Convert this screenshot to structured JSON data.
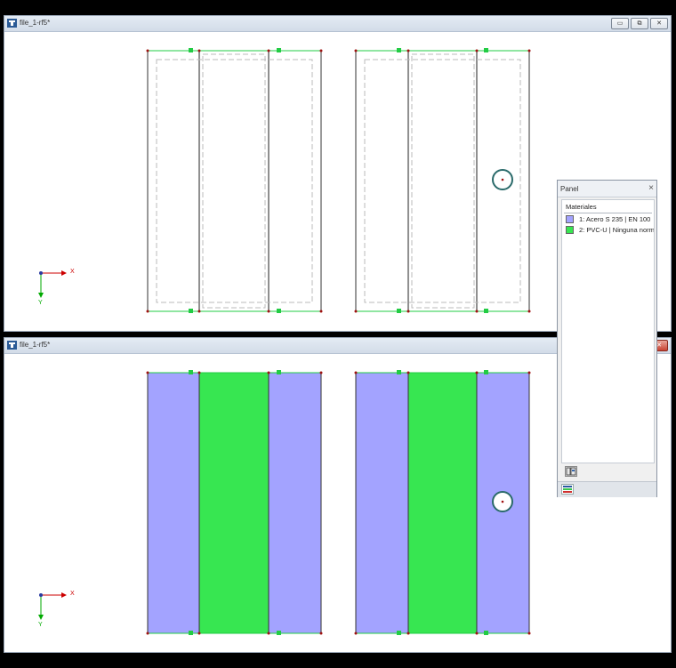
{
  "windows": [
    {
      "title": "file_1-rf5*",
      "controls": [
        "minimize",
        "maximize",
        "close"
      ]
    },
    {
      "title": "file_1-rf5*",
      "controls": [
        "close"
      ]
    }
  ],
  "axes": {
    "x_label": "X",
    "y_label": "Y"
  },
  "panel": {
    "title": "Panel",
    "section": "Materiales",
    "materials": [
      {
        "label": "1: Acero S 235 | EN 100",
        "color": "#a3a3ff"
      },
      {
        "label": "2: PVC-U | Ninguna norm",
        "color": "#37e651"
      }
    ]
  },
  "colors": {
    "steel": "#a3a3ff",
    "pvc": "#37e651",
    "node_green": "#22cc44",
    "node_red": "#a01010",
    "axis_x": "#cc0000",
    "axis_y": "#00aa00"
  },
  "icons": {
    "window_icon": "model-window-icon",
    "panel_tool": "panel-options-icon",
    "panel_tab": "color-legend-icon"
  }
}
